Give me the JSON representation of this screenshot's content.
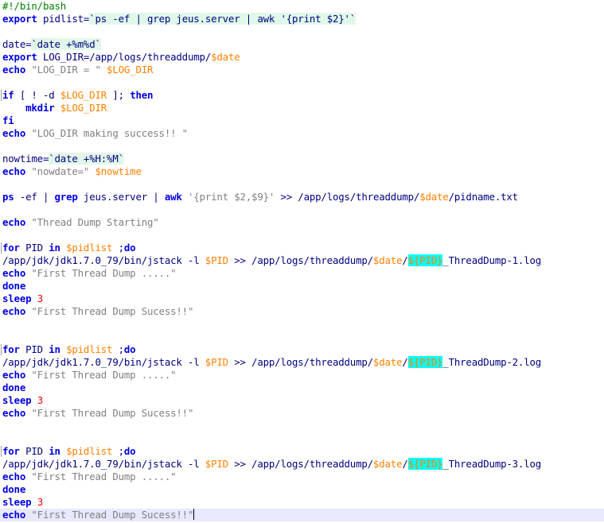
{
  "editor": {
    "lines": [
      [
        [
          "#!/bin/bash",
          "comment"
        ]
      ],
      [
        [
          "export",
          "kw"
        ],
        [
          " pidlist=",
          "plain"
        ],
        [
          "`ps -ef | grep jeus.server | awk '{print $2}'`",
          "bq"
        ]
      ],
      [],
      [
        [
          "date=",
          "plain"
        ],
        [
          "`date +%m%d`",
          "bq"
        ]
      ],
      [
        [
          "export",
          "kw"
        ],
        [
          " LOG_DIR=/app/logs/threaddump/",
          "plain"
        ],
        [
          "$date",
          "var"
        ]
      ],
      [
        [
          "echo",
          "kw"
        ],
        [
          " ",
          "plain"
        ],
        [
          "\"LOG_DIR = \"",
          "str"
        ],
        [
          " ",
          "plain"
        ],
        [
          "$LOG_DIR",
          "var"
        ]
      ],
      [],
      [
        [
          "if",
          "kw"
        ],
        [
          " [ ! -d ",
          "plain"
        ],
        [
          "$LOG_DIR",
          "var"
        ],
        [
          " ]; ",
          "plain"
        ],
        [
          "then",
          "kw"
        ]
      ],
      [
        [
          "    mkdir",
          "kw"
        ],
        [
          " ",
          "plain"
        ],
        [
          "$LOG_DIR",
          "var"
        ]
      ],
      [
        [
          "fi",
          "kw"
        ]
      ],
      [
        [
          "echo",
          "kw"
        ],
        [
          " ",
          "plain"
        ],
        [
          "\"LOG_DIR making success!! \"",
          "str"
        ]
      ],
      [],
      [
        [
          "nowtime=",
          "plain"
        ],
        [
          "`date +%H:%M`",
          "bq"
        ]
      ],
      [
        [
          "echo",
          "kw"
        ],
        [
          " ",
          "plain"
        ],
        [
          "\"nowdate=\"",
          "str"
        ],
        [
          " ",
          "plain"
        ],
        [
          "$nowtime",
          "var"
        ]
      ],
      [],
      [
        [
          "ps",
          "kw"
        ],
        [
          " -ef | ",
          "plain"
        ],
        [
          "grep",
          "kw"
        ],
        [
          " jeus.server | ",
          "plain"
        ],
        [
          "awk",
          "kw"
        ],
        [
          " ",
          "plain"
        ],
        [
          "'{print $2,$9}'",
          "str"
        ],
        [
          " >> /app/logs/threaddump/",
          "plain"
        ],
        [
          "$date",
          "var"
        ],
        [
          "/pidname.txt",
          "plain"
        ]
      ],
      [],
      [
        [
          "echo",
          "kw"
        ],
        [
          " ",
          "plain"
        ],
        [
          "\"Thread Dump Starting\"",
          "str"
        ]
      ],
      [],
      [
        [
          "for",
          "kw"
        ],
        [
          " PID ",
          "plain"
        ],
        [
          "in",
          "kw"
        ],
        [
          " ",
          "plain"
        ],
        [
          "$pidlist",
          "var"
        ],
        [
          " ;",
          "plain"
        ],
        [
          "do",
          "kw"
        ]
      ],
      [
        [
          "/app/jdk/jdk1.7.0_79/bin/jstack -l ",
          "plain"
        ],
        [
          "$PID",
          "var"
        ],
        [
          " >> /app/logs/threaddump/",
          "plain"
        ],
        [
          "$date",
          "var"
        ],
        [
          "/",
          "plain"
        ],
        [
          "${PID}",
          "hl"
        ],
        [
          "_ThreadDump-1.log",
          "plain"
        ]
      ],
      [
        [
          "echo",
          "kw"
        ],
        [
          " ",
          "plain"
        ],
        [
          "\"First Thread Dump .....\"",
          "str"
        ]
      ],
      [
        [
          "done",
          "kw"
        ]
      ],
      [
        [
          "sleep",
          "kw"
        ],
        [
          " ",
          "plain"
        ],
        [
          "3",
          "num"
        ]
      ],
      [
        [
          "echo",
          "kw"
        ],
        [
          " ",
          "plain"
        ],
        [
          "\"First Thread Dump Sucess!!\"",
          "str"
        ]
      ],
      [],
      [],
      [
        [
          "for",
          "kw"
        ],
        [
          " PID ",
          "plain"
        ],
        [
          "in",
          "kw"
        ],
        [
          " ",
          "plain"
        ],
        [
          "$pidlist",
          "var"
        ],
        [
          " ;",
          "plain"
        ],
        [
          "do",
          "kw"
        ]
      ],
      [
        [
          "/app/jdk/jdk1.7.0_79/bin/jstack -l ",
          "plain"
        ],
        [
          "$PID",
          "var"
        ],
        [
          " >> /app/logs/threaddump/",
          "plain"
        ],
        [
          "$date",
          "var"
        ],
        [
          "/",
          "plain"
        ],
        [
          "${PID}",
          "hl"
        ],
        [
          "_ThreadDump-2.log",
          "plain"
        ]
      ],
      [
        [
          "echo",
          "kw"
        ],
        [
          " ",
          "plain"
        ],
        [
          "\"First Thread Dump .....\"",
          "str"
        ]
      ],
      [
        [
          "done",
          "kw"
        ]
      ],
      [
        [
          "sleep",
          "kw"
        ],
        [
          " ",
          "plain"
        ],
        [
          "3",
          "num"
        ]
      ],
      [
        [
          "echo",
          "kw"
        ],
        [
          " ",
          "plain"
        ],
        [
          "\"First Thread Dump Sucess!!\"",
          "str"
        ]
      ],
      [],
      [],
      [
        [
          "for",
          "kw"
        ],
        [
          " PID ",
          "plain"
        ],
        [
          "in",
          "kw"
        ],
        [
          " ",
          "plain"
        ],
        [
          "$pidlist",
          "var"
        ],
        [
          " ;",
          "plain"
        ],
        [
          "do",
          "kw"
        ]
      ],
      [
        [
          "/app/jdk/jdk1.7.0_79/bin/jstack -l ",
          "plain"
        ],
        [
          "$PID",
          "var"
        ],
        [
          " >> /app/logs/threaddump/",
          "plain"
        ],
        [
          "$date",
          "var"
        ],
        [
          "/",
          "plain"
        ],
        [
          "${PID}",
          "hl"
        ],
        [
          "_ThreadDump-3.log",
          "plain"
        ]
      ],
      [
        [
          "echo",
          "kw"
        ],
        [
          " ",
          "plain"
        ],
        [
          "\"First Thread Dump .....\"",
          "str"
        ]
      ],
      [
        [
          "done",
          "kw"
        ]
      ],
      [
        [
          "sleep",
          "kw"
        ],
        [
          " ",
          "plain"
        ],
        [
          "3",
          "num"
        ]
      ],
      [
        [
          "echo",
          "kw"
        ],
        [
          " ",
          "plain"
        ],
        [
          "\"First Thread Dump Sucess!!\"",
          "str"
        ]
      ]
    ],
    "current_line": 40,
    "fold_lines": [
      7,
      19,
      27,
      35
    ],
    "colors": {
      "keyword": "#0000e0",
      "string": "#808080",
      "variable": "#ff8000",
      "number": "#ff0000",
      "comment": "#008000",
      "backquote_bg": "#e2f7e9",
      "highlight_bg": "#00ffff",
      "current_line_bg": "#e8e8ff"
    }
  }
}
